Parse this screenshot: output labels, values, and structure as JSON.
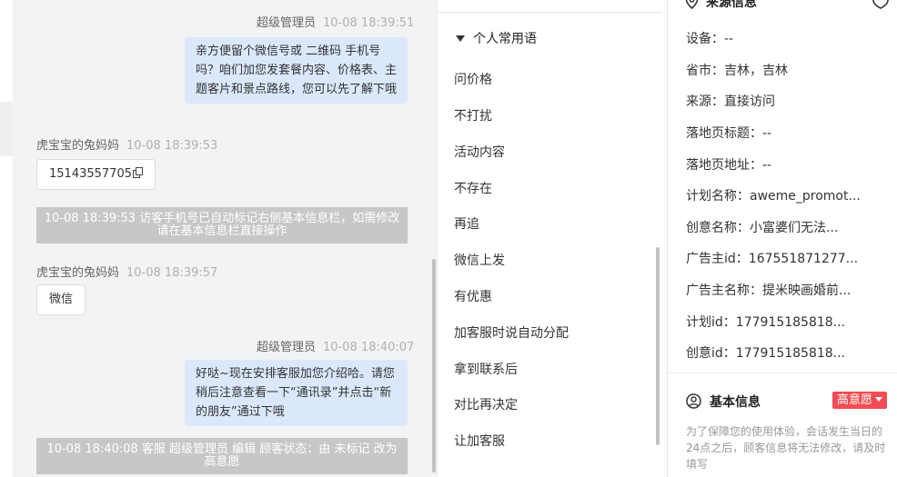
{
  "chat": {
    "messages": [
      {
        "sender": "超级管理员",
        "time": "10-08 18:39:51",
        "text": "亲方便留个微信号或 二维码 手机号吗？咱们加您发套餐内容、价格表、主题客片和景点路线，您可以先了解下哦"
      },
      {
        "sender": "虎宝宝的兔妈妈",
        "time": "10-08 18:39:53",
        "text": "15143557705"
      },
      {
        "system": "10-08 18:39:53 访客手机号已自动标记右侧基本信息栏，如需修改请在基本信息栏直接操作"
      },
      {
        "sender": "虎宝宝的兔妈妈",
        "time": "10-08 18:39:57",
        "text": "微信"
      },
      {
        "sender": "超级管理员",
        "time": "10-08 18:40:07",
        "text": "好哒~现在安排客服加您介绍哈。请您稍后注意查看一下“通讯录”并点击“新的朋友”通过下哦"
      },
      {
        "system": "10-08 18:40:08 客服 超级管理员 编辑 顾客状态：由 未标记 改为 高意愿"
      }
    ]
  },
  "phrases": {
    "header": "个人常用语",
    "items": [
      "问价格",
      "不打扰",
      "活动内容",
      "不存在",
      "再追",
      "微信上发",
      "有优惠",
      "加客服时说自动分配",
      "拿到联系后",
      "对比再决定",
      "让加客服"
    ]
  },
  "info": {
    "source_header": "来源信息",
    "rows": [
      {
        "label": "设备：",
        "value": "--"
      },
      {
        "label": "省市：",
        "value": "吉林，吉林"
      },
      {
        "label": "来源：",
        "value": "直接访问"
      },
      {
        "label": "落地页标题：",
        "value": "--"
      },
      {
        "label": "落地页地址：",
        "value": "--"
      },
      {
        "label": "计划名称：",
        "value": "aweme_promot..."
      },
      {
        "label": "创意名称：",
        "value": "小富婆们无法..."
      },
      {
        "label": "广告主id：",
        "value": "167551871277..."
      },
      {
        "label": "广告主名称：",
        "value": "提米映画婚前..."
      },
      {
        "label": "计划id：",
        "value": "177915185818..."
      },
      {
        "label": "创意id：",
        "value": "177915185818..."
      }
    ],
    "basic_header": "基本信息",
    "intent_badge": "高意愿",
    "notice": "为了保障您的使用体验，会话发生当日的24点之后，顾客信息将无法修改，请及时填写"
  },
  "colors": {
    "accent_bubble": "#dbe8fc",
    "badge_red": "#f14d55",
    "system_bar": "#c7c7c7"
  },
  "icons": [
    "copy-icon",
    "location-pin-icon",
    "shield-icon",
    "user-circle-icon",
    "caret-down-icon"
  ]
}
